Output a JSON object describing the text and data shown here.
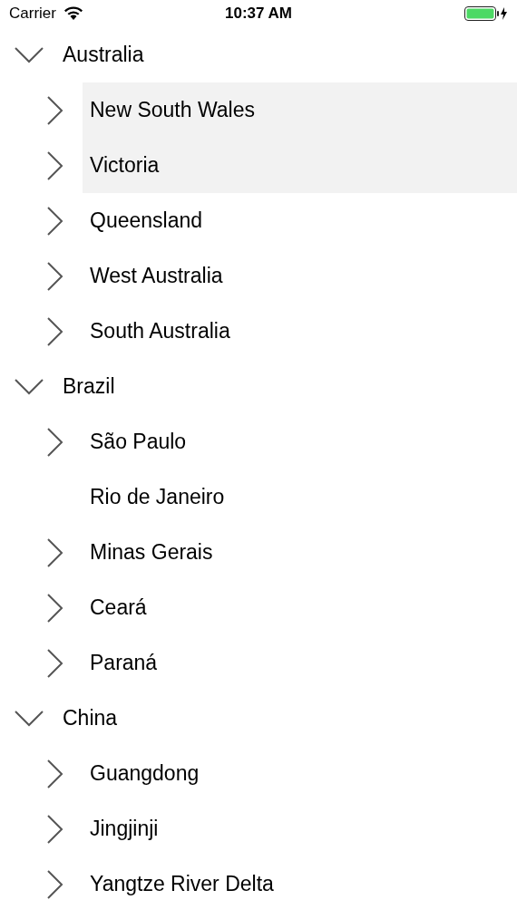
{
  "status_bar": {
    "carrier": "Carrier",
    "time": "10:37 AM"
  },
  "tree": [
    {
      "label": "Australia",
      "kind": "branch",
      "expanded": true,
      "selected": false,
      "children": [
        {
          "label": "New South Wales",
          "kind": "branch",
          "selected": true
        },
        {
          "label": "Victoria",
          "kind": "branch",
          "selected": true
        },
        {
          "label": "Queensland",
          "kind": "branch",
          "selected": false
        },
        {
          "label": "West Australia",
          "kind": "branch",
          "selected": false
        },
        {
          "label": "South Australia",
          "kind": "branch",
          "selected": false
        }
      ]
    },
    {
      "label": "Brazil",
      "kind": "branch",
      "expanded": true,
      "selected": false,
      "children": [
        {
          "label": "São Paulo",
          "kind": "branch",
          "selected": false
        },
        {
          "label": "Rio de Janeiro",
          "kind": "leaf",
          "selected": false
        },
        {
          "label": "Minas Gerais",
          "kind": "branch",
          "selected": false
        },
        {
          "label": "Ceará",
          "kind": "branch",
          "selected": false
        },
        {
          "label": "Paraná",
          "kind": "branch",
          "selected": false
        }
      ]
    },
    {
      "label": "China",
      "kind": "branch",
      "expanded": true,
      "selected": false,
      "children": [
        {
          "label": "Guangdong",
          "kind": "branch",
          "selected": false
        },
        {
          "label": "Jingjinji",
          "kind": "branch",
          "selected": false
        },
        {
          "label": "Yangtze River Delta",
          "kind": "branch",
          "selected": false
        }
      ]
    }
  ]
}
